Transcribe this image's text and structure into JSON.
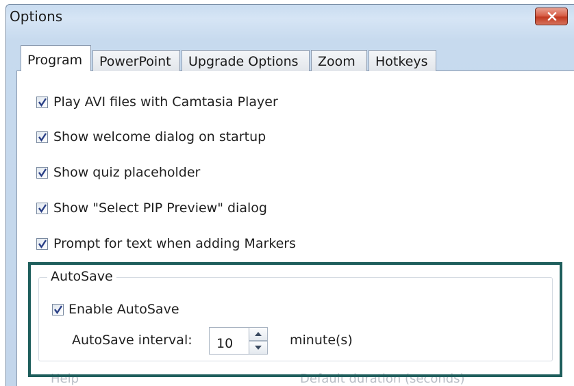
{
  "window": {
    "title": "Options"
  },
  "tabs": [
    {
      "label": "Program",
      "active": true
    },
    {
      "label": "PowerPoint",
      "active": false
    },
    {
      "label": "Upgrade Options",
      "active": false
    },
    {
      "label": "Zoom",
      "active": false
    },
    {
      "label": "Hotkeys",
      "active": false
    }
  ],
  "options": [
    {
      "label": "Play AVI files with Camtasia Player",
      "checked": true
    },
    {
      "label": "Show welcome dialog on startup",
      "checked": true
    },
    {
      "label": "Show quiz placeholder",
      "checked": true
    },
    {
      "label": "Show \"Select PIP Preview\" dialog",
      "checked": true
    },
    {
      "label": "Prompt for text when adding Markers",
      "checked": true
    }
  ],
  "autosave": {
    "group_title": "AutoSave",
    "enable_label": "Enable AutoSave",
    "enable_checked": true,
    "interval_label": "AutoSave interval:",
    "interval_value": "10",
    "interval_units": "minute(s)"
  },
  "partial_below": {
    "left": "Help",
    "right": "Default duration (seconds)"
  },
  "colors": {
    "highlight_border": "#1e5e5c",
    "close_button": "#c23a22",
    "title_bar": "#c9dcf0"
  }
}
